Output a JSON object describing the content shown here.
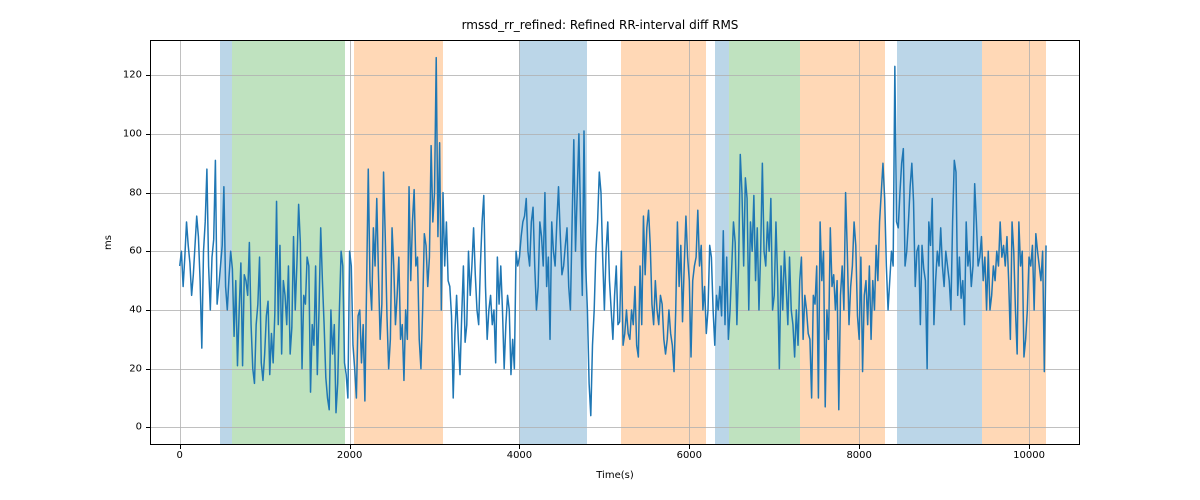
{
  "chart_data": {
    "type": "line",
    "title": "rmssd_rr_refined: Refined RR-interval diff RMS",
    "xlabel": "Time(s)",
    "ylabel": "ms",
    "xlim": [
      -350,
      10600
    ],
    "ylim": [
      -6,
      132
    ],
    "xticks": [
      0,
      2000,
      4000,
      6000,
      8000,
      10000
    ],
    "yticks": [
      0,
      20,
      40,
      60,
      80,
      100,
      120
    ],
    "spans": [
      {
        "x0": 470,
        "x1": 620,
        "color": "#1f77b4"
      },
      {
        "x0": 620,
        "x1": 1950,
        "color": "#2ca02c"
      },
      {
        "x0": 2050,
        "x1": 3100,
        "color": "#ff7f0e"
      },
      {
        "x0": 4000,
        "x1": 4800,
        "color": "#1f77b4"
      },
      {
        "x0": 5200,
        "x1": 6200,
        "color": "#ff7f0e"
      },
      {
        "x0": 6300,
        "x1": 6470,
        "color": "#1f77b4"
      },
      {
        "x0": 6470,
        "x1": 7300,
        "color": "#2ca02c"
      },
      {
        "x0": 7300,
        "x1": 8300,
        "color": "#ff7f0e"
      },
      {
        "x0": 8450,
        "x1": 9450,
        "color": "#1f77b4"
      },
      {
        "x0": 9450,
        "x1": 10200,
        "color": "#ff7f0e"
      }
    ],
    "series": [
      {
        "name": "rmssd",
        "color": "#1f77b4",
        "x_step": 20,
        "x_start": 0,
        "values": [
          55,
          60,
          48,
          58,
          70,
          62,
          56,
          45,
          52,
          62,
          72,
          65,
          50,
          27,
          60,
          70,
          88,
          55,
          40,
          58,
          64,
          91,
          42,
          48,
          55,
          62,
          82,
          48,
          40,
          51,
          60,
          54,
          31,
          50,
          21,
          40,
          56,
          21,
          52,
          50,
          45,
          63,
          35,
          20,
          15,
          35,
          42,
          58,
          22,
          16,
          25,
          38,
          43,
          18,
          32,
          22,
          39,
          77,
          35,
          62,
          25,
          50,
          45,
          35,
          55,
          25,
          34,
          65,
          40,
          56,
          76,
          63,
          20,
          45,
          42,
          58,
          55,
          12,
          35,
          28,
          55,
          18,
          40,
          68,
          50,
          35,
          17,
          10,
          6,
          40,
          25,
          35,
          5,
          15,
          40,
          60,
          55,
          22,
          18,
          10,
          60,
          55,
          28,
          20,
          10,
          38,
          40,
          22,
          35,
          9,
          48,
          88,
          50,
          40,
          68,
          55,
          78,
          52,
          30,
          42,
          87,
          65,
          38,
          20,
          30,
          68,
          55,
          35,
          45,
          58,
          30,
          35,
          16,
          40,
          30,
          82,
          50,
          70,
          81,
          55,
          58,
          30,
          20,
          40,
          66,
          62,
          48,
          58,
          96,
          70,
          80,
          126,
          65,
          97,
          40,
          80,
          55,
          70,
          50,
          48,
          38,
          10,
          32,
          45,
          30,
          18,
          38,
          55,
          29,
          35,
          60,
          45,
          55,
          68,
          52,
          40,
          35,
          55,
          70,
          79,
          48,
          30,
          40,
          45,
          35,
          40,
          22,
          58,
          42,
          55,
          40,
          20,
          35,
          45,
          40,
          18,
          30,
          20,
          60,
          55,
          58,
          65,
          70,
          72,
          78,
          60,
          55,
          70,
          75,
          55,
          40,
          48,
          70,
          65,
          55,
          80,
          48,
          58,
          30,
          70,
          60,
          55,
          70,
          82,
          66,
          52,
          55,
          62,
          68,
          48,
          40,
          70,
          98,
          60,
          80,
          100,
          70,
          45,
          101,
          55,
          40,
          15,
          4,
          28,
          40,
          60,
          70,
          87,
          80,
          58,
          40,
          60,
          70,
          50,
          40,
          30,
          45,
          55,
          35,
          36,
          60,
          28,
          32,
          40,
          32,
          30,
          40,
          35,
          48,
          28,
          24,
          55,
          35,
          72,
          52,
          68,
          74,
          62,
          42,
          35,
          50,
          40,
          35,
          45,
          42,
          30,
          25,
          30,
          40,
          32,
          28,
          19,
          40,
          70,
          48,
          62,
          36,
          55,
          72,
          58,
          50,
          24,
          50,
          55,
          58,
          74,
          55,
          62,
          40,
          48,
          32,
          40,
          62,
          58,
          40,
          28,
          45,
          40,
          48,
          38,
          67,
          35,
          58,
          30,
          40,
          55,
          70,
          63,
          35,
          55,
          93,
          80,
          55,
          85,
          78,
          40,
          70,
          60,
          79,
          50,
          68,
          40,
          60,
          90,
          60,
          55,
          70,
          60,
          78,
          40,
          45,
          70,
          50,
          20,
          55,
          40,
          60,
          48,
          35,
          58,
          40,
          35,
          24,
          40,
          28,
          50,
          58,
          30,
          45,
          40,
          32,
          30,
          10,
          45,
          42,
          55,
          10,
          70,
          50,
          60,
          7,
          40,
          30,
          68,
          48,
          52,
          40,
          50,
          6,
          45,
          55,
          40,
          80,
          60,
          35,
          48,
          55,
          70,
          62,
          38,
          30,
          58,
          19,
          45,
          50,
          35,
          55,
          30,
          50,
          40,
          62,
          50,
          70,
          80,
          90,
          78,
          55,
          40,
          50,
          60,
          55,
          123,
          70,
          68,
          80,
          90,
          95,
          55,
          60,
          70,
          82,
          90,
          77,
          48,
          60,
          62,
          35,
          62,
          54,
          50,
          20,
          70,
          62,
          78,
          35,
          50,
          60,
          55,
          68,
          55,
          48,
          60,
          55,
          50,
          40,
          70,
          91,
          87,
          45,
          58,
          44,
          50,
          35,
          70,
          55,
          60,
          48,
          55,
          83,
          70,
          55,
          58,
          65,
          50,
          58,
          40,
          60,
          40,
          45,
          55,
          50,
          60,
          55,
          70,
          58,
          62,
          55,
          65,
          50,
          30,
          70,
          60,
          40,
          25,
          70,
          55,
          60,
          24,
          30,
          40,
          58,
          55,
          62,
          40,
          66,
          60,
          55,
          50,
          60,
          19,
          62
        ]
      }
    ]
  }
}
